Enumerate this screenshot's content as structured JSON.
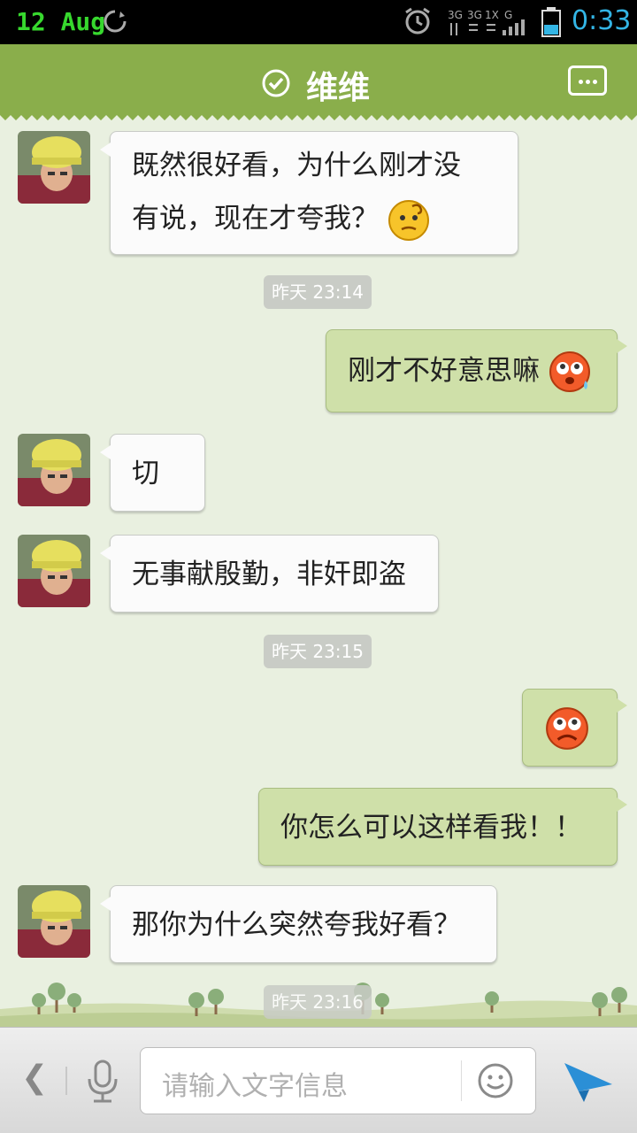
{
  "status_bar": {
    "date": "12 Aug",
    "time": "0:33",
    "network": [
      "3G",
      "3G",
      "1X",
      "G"
    ],
    "icons": [
      "sync-icon",
      "alarm-icon",
      "signal-icon",
      "battery-icon"
    ]
  },
  "title_bar": {
    "contact_name": "维维",
    "icons": [
      "verified-check-icon",
      "more-icon"
    ],
    "color": "#8aae4b"
  },
  "messages": [
    {
      "side": "left",
      "line1": "既然很好看，为什么刚才没",
      "line2": "有说，现在才夸我？",
      "emoji": "confused-emoji-icon"
    },
    {
      "type": "time",
      "text": "昨天 23:14"
    },
    {
      "side": "right",
      "text": "刚才不好意思嘛",
      "emoji": "sweat-emoji-icon"
    },
    {
      "side": "left",
      "text": "切"
    },
    {
      "side": "left",
      "text": "无事献殷勤，非奸即盗"
    },
    {
      "type": "time",
      "text": "昨天 23:15"
    },
    {
      "side": "right",
      "text": "",
      "emoji": "sad-emoji-icon"
    },
    {
      "side": "right",
      "text": "你怎么可以这样看我！！"
    },
    {
      "side": "left",
      "text": "那你为什么突然夸我好看？"
    },
    {
      "type": "time",
      "text": "昨天 23:16"
    }
  ],
  "input_bar": {
    "placeholder": "请输入文字信息",
    "icons": [
      "back-icon",
      "microphone-icon",
      "smiley-icon",
      "send-icon"
    ]
  }
}
